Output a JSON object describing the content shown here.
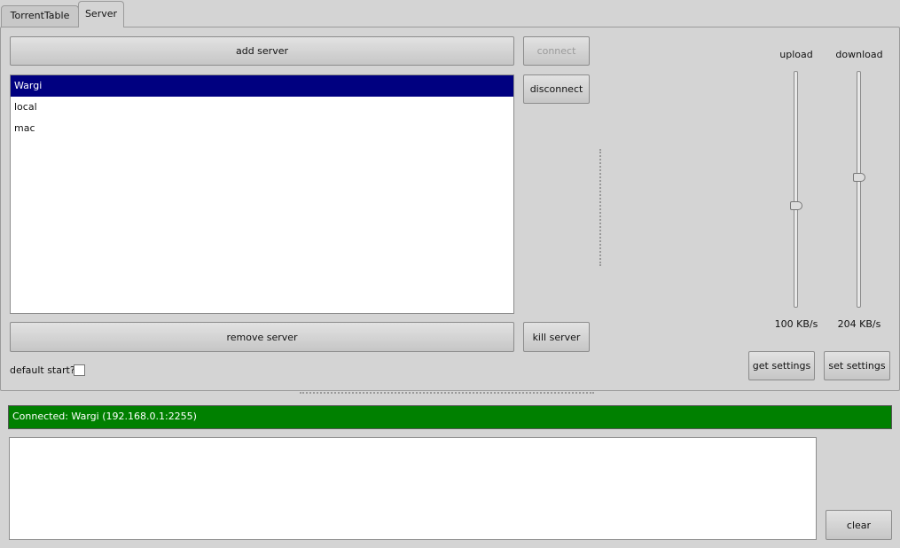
{
  "tabs": [
    {
      "label": "TorrentTable"
    },
    {
      "label": "Server"
    }
  ],
  "active_tab": "Server",
  "server": {
    "add_server": "add server",
    "connect": "connect",
    "disconnect": "disconnect",
    "remove_server": "remove server",
    "kill_server": "kill server",
    "servers": [
      "Wargi",
      "local",
      "mac"
    ],
    "selected_server": "Wargi",
    "default_start_label": "default start?",
    "default_start_checked": false
  },
  "limits": {
    "upload_label": "upload",
    "download_label": "download",
    "upload_value": "100 KB/s",
    "download_value": "204 KB/s",
    "upload_level": 0.43,
    "download_level": 0.55,
    "get_settings": "get settings",
    "set_settings": "set settings"
  },
  "status": {
    "text": "Connected: Wargi  (192.168.0.1:2255)",
    "color": "#008000"
  },
  "log": {
    "text": ""
  },
  "clear": "clear"
}
